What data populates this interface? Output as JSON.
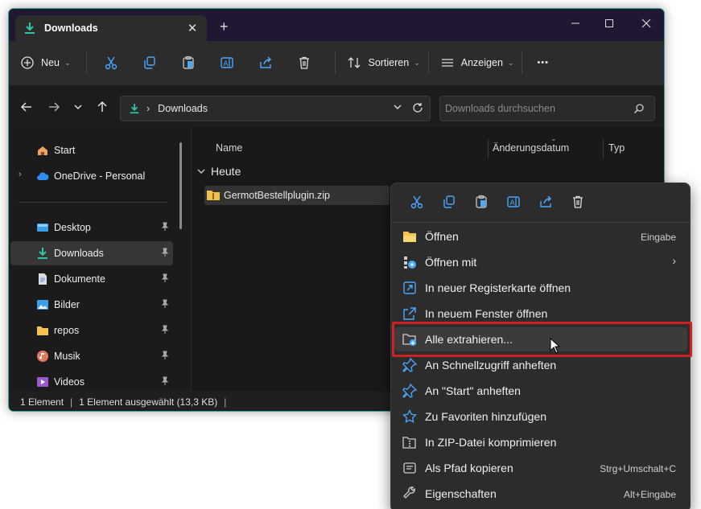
{
  "window": {
    "tab_title": "Downloads",
    "new_tab": "+",
    "toolbar": {
      "new_label": "Neu",
      "sort_label": "Sortieren",
      "view_label": "Anzeigen",
      "more_label": "•••"
    },
    "address": {
      "path": "Downloads",
      "search_placeholder": "Downloads durchsuchen"
    },
    "sidebar": {
      "items": [
        {
          "label": "Start",
          "icon": "home-icon"
        },
        {
          "label": "OneDrive - Personal",
          "icon": "cloud-icon"
        },
        {
          "label": "Desktop",
          "icon": "desktop-icon",
          "pinned": true
        },
        {
          "label": "Downloads",
          "icon": "download-icon",
          "pinned": true,
          "selected": true
        },
        {
          "label": "Dokumente",
          "icon": "document-icon",
          "pinned": true
        },
        {
          "label": "Bilder",
          "icon": "picture-icon",
          "pinned": true
        },
        {
          "label": "repos",
          "icon": "folder-icon",
          "pinned": true
        },
        {
          "label": "Musik",
          "icon": "music-icon",
          "pinned": true
        },
        {
          "label": "Videos",
          "icon": "video-icon",
          "pinned": true
        }
      ]
    },
    "content": {
      "columns": [
        "Name",
        "Änderungsdatum",
        "Typ"
      ],
      "group": "Heute",
      "file": "GermotBestellplugin.zip"
    },
    "status": {
      "count": "1 Element",
      "selection": "1 Element ausgewählt (13,3 KB)"
    }
  },
  "context_menu": {
    "items": [
      {
        "label": "Öffnen",
        "shortcut": "Eingabe",
        "icon": "folder-open-icon"
      },
      {
        "label": "Öffnen mit",
        "shortcut": "",
        "icon": "open-with-icon",
        "submenu": true
      },
      {
        "label": "In neuer Registerkarte öffnen",
        "shortcut": "",
        "icon": "new-tab-icon"
      },
      {
        "label": "In neuem Fenster öffnen",
        "shortcut": "",
        "icon": "new-window-icon"
      },
      {
        "label": "Alle extrahieren...",
        "shortcut": "",
        "icon": "extract-icon",
        "highlighted": true
      },
      {
        "label": "An Schnellzugriff anheften",
        "shortcut": "",
        "icon": "pin-icon"
      },
      {
        "label": "An \"Start\" anheften",
        "shortcut": "",
        "icon": "pin-start-icon"
      },
      {
        "label": "Zu Favoriten hinzufügen",
        "shortcut": "",
        "icon": "star-icon"
      },
      {
        "label": "In ZIP-Datei komprimieren",
        "shortcut": "",
        "icon": "zip-icon"
      },
      {
        "label": "Als Pfad kopieren",
        "shortcut": "Strg+Umschalt+C",
        "icon": "copy-path-icon"
      },
      {
        "label": "Eigenschaften",
        "shortcut": "Alt+Eingabe",
        "icon": "wrench-icon"
      }
    ]
  },
  "colors": {
    "accent": "#3aa6a0",
    "titlebar": "#201733",
    "highlight_frame": "#cc2222",
    "icon_blue": "#4aa8ff"
  }
}
